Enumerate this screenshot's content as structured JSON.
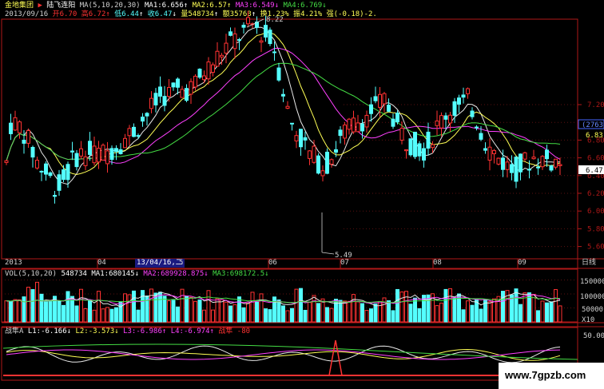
{
  "header": {
    "stock_name": "金地集团",
    "arrow": "▶",
    "pattern": "陆飞连阳",
    "ma_label": "MA(5,10,20,30)",
    "ma1": "MA1:6.656",
    "ma2": "MA2:6.57",
    "ma3": "MA3:6.549",
    "ma4": "MA4:6.769",
    "date": "2013/09/16",
    "open": "开6.70",
    "high": "高6.72",
    "low": "低6.44",
    "close": "收6.47",
    "volume": "量548734",
    "amount": "额35763",
    "turnover": "换1.23%",
    "change_pct": "振4.21%",
    "strength": "强(-0.18)-2."
  },
  "price_axis": {
    "ticks": [
      "7.20",
      "7.00",
      "6.80",
      "6.60",
      "6.40",
      "6.20",
      "6.00",
      "5.80",
      "5.60"
    ],
    "current_box": "(2763)",
    "current_a": "6.83",
    "current_b": "6.47"
  },
  "annotations": {
    "high_marker": "8.22",
    "low_marker": "5.49"
  },
  "time_axis": {
    "labels": [
      "2013",
      "04",
      "13/04/16,二",
      "06",
      "07",
      "08",
      "09"
    ],
    "cursor_tail": "5",
    "period": "日线"
  },
  "volume_panel": {
    "label": "VOL(5,10,20)",
    "value": "548734",
    "ma1": "MA1:680145",
    "ma2": "MA2:689928.875",
    "ma3": "MA3:698172.5",
    "ticks": [
      "150000",
      "100000",
      "50000"
    ],
    "unit": "X10"
  },
  "indicator_panel": {
    "name": "战隼A",
    "l1": "L1:-6.166",
    "l2": "L2:-3.573",
    "l3": "L3:-6.986",
    "l4": "L4:-6.974",
    "zy": "战隼",
    "zy_val": "-80",
    "ticks": [
      "50.00"
    ]
  },
  "watermark": "www.7gpzb.com",
  "colors": {
    "up": "#ff3232",
    "down": "#54ffff",
    "ma_white": "#e8e8e8",
    "ma_yellow": "#ffff55",
    "ma_purple": "#ff40ff",
    "ma_green": "#44dd44",
    "frame": "#b01818"
  }
}
